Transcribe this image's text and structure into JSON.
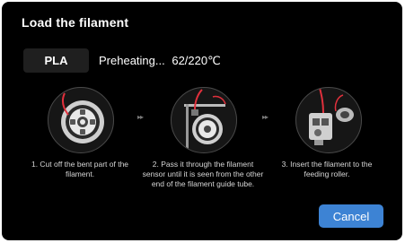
{
  "dialog": {
    "title": "Load the filament",
    "material": "PLA",
    "status_text": "Preheating...",
    "temperature": "62/220℃"
  },
  "steps": [
    {
      "text": "1. Cut off the bent part  of the filament.",
      "icon": "filament-spool-icon"
    },
    {
      "text": "2. Pass it through the filament sensor until it is seen from the other end of the filament guide tube.",
      "icon": "filament-sensor-icon"
    },
    {
      "text": "3. Insert the filament to the feeding roller.",
      "icon": "extruder-roller-icon"
    }
  ],
  "arrows": [
    "▸▸",
    "▸▸"
  ],
  "buttons": {
    "cancel": "Cancel"
  },
  "colors": {
    "background": "#000000",
    "accent": "#3d83d4",
    "filament": "#e0303c"
  }
}
